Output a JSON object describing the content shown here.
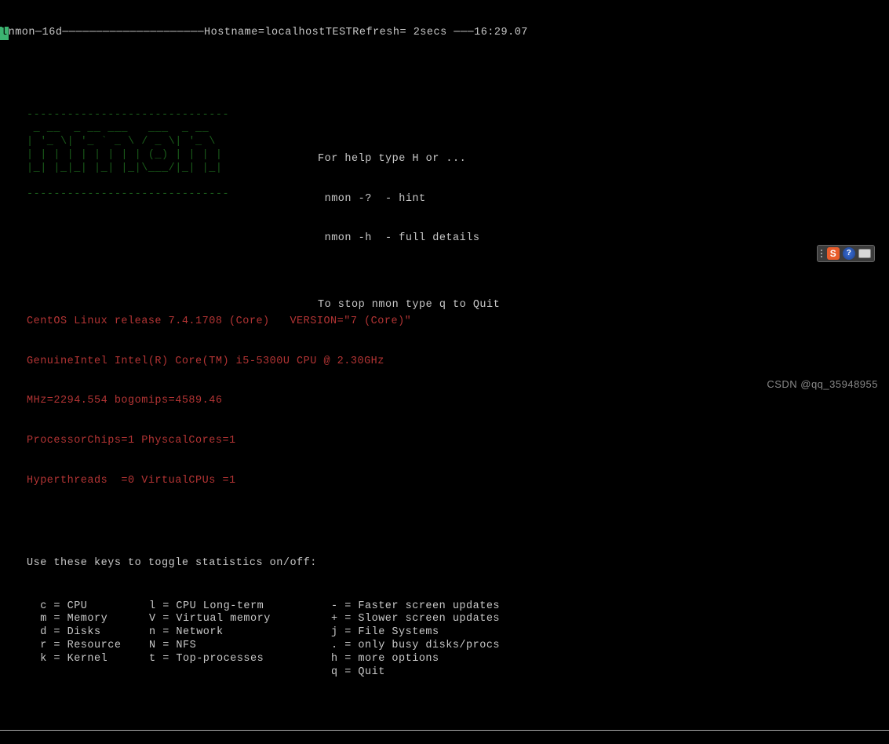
{
  "header": {
    "prompt": "l",
    "left": "nmon─16d─────────────────────Hostname=localhostTESTRefresh= 2secs ───16:29.07"
  },
  "ascii": "------------------------------\n _ __  _ __ ___   ___  _ __  \n| '_ \\| '_ ` _ \\ / _ \\| '_ \\ \n| | | | | | | | | (_) | | | |\n|_| |_|_| |_| |_|\\___/|_| |_|\n                             \n------------------------------",
  "help": {
    "l1": "For help type H or ...",
    "l2": " nmon -?  - hint",
    "l3": " nmon -h  - full details",
    "l4": "",
    "l5": "To stop nmon type q to Quit"
  },
  "sys": {
    "l1": "CentOS Linux release 7.4.1708 (Core)   VERSION=\"7 (Core)\"",
    "l2": "GenuineIntel Intel(R) Core(TM) i5-5300U CPU @ 2.30GHz",
    "l3": "MHz=2294.554 bogomips=4589.46",
    "l4": "ProcessorChips=1 PhyscalCores=1",
    "l5": "Hyperthreads  =0 VirtualCPUs =1"
  },
  "keys": {
    "heading": "Use these keys to toggle statistics on/off:",
    "rows": [
      {
        "a": "  c = CPU",
        "b": "l = CPU Long-term",
        "c": "- = Faster screen updates"
      },
      {
        "a": "  m = Memory",
        "b": "V = Virtual memory",
        "c": "+ = Slower screen updates"
      },
      {
        "a": "  d = Disks",
        "b": "n = Network",
        "c": "j = File Systems"
      },
      {
        "a": "  r = Resource",
        "b": "N = NFS",
        "c": ". = only busy disks/procs"
      },
      {
        "a": "  k = Kernel",
        "b": "t = Top-processes",
        "c": "h = more options"
      },
      {
        "a": "",
        "b": "",
        "c": "q = Quit"
      }
    ]
  },
  "tray": {
    "s": "S",
    "q": "?"
  },
  "watermark": "CSDN @qq_35948955"
}
